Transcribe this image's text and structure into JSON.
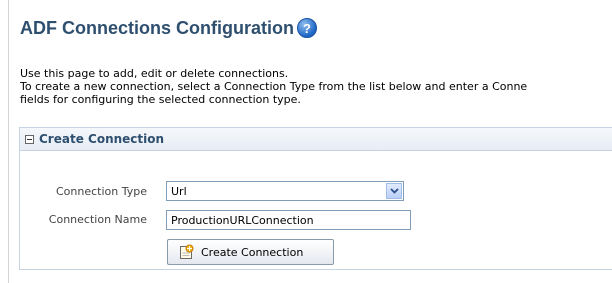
{
  "page": {
    "title": "ADF Connections Configuration",
    "help_glyph": "?",
    "intro_lines": [
      "Use this page to add, edit or delete connections.",
      "To create a new connection, select a Connection Type from the list below and enter a Conne",
      "fields for configuring the selected connection type."
    ]
  },
  "panel": {
    "title": "Create Connection",
    "connection_type_label": "Connection Type",
    "connection_type_value": "Url",
    "connection_name_label": "Connection Name",
    "connection_name_value": "ProductionURLConnection",
    "create_button_label": "Create Connection"
  },
  "icons": {
    "help": "help-icon",
    "collapse": "collapse-icon",
    "dropdown": "chevron-down-icon",
    "create": "new-document-icon"
  },
  "colors": {
    "title": "#2f4f6f",
    "panel_border": "#c5d3e2",
    "input_border": "#7f9db9",
    "help_icon": "#1d64c4"
  }
}
